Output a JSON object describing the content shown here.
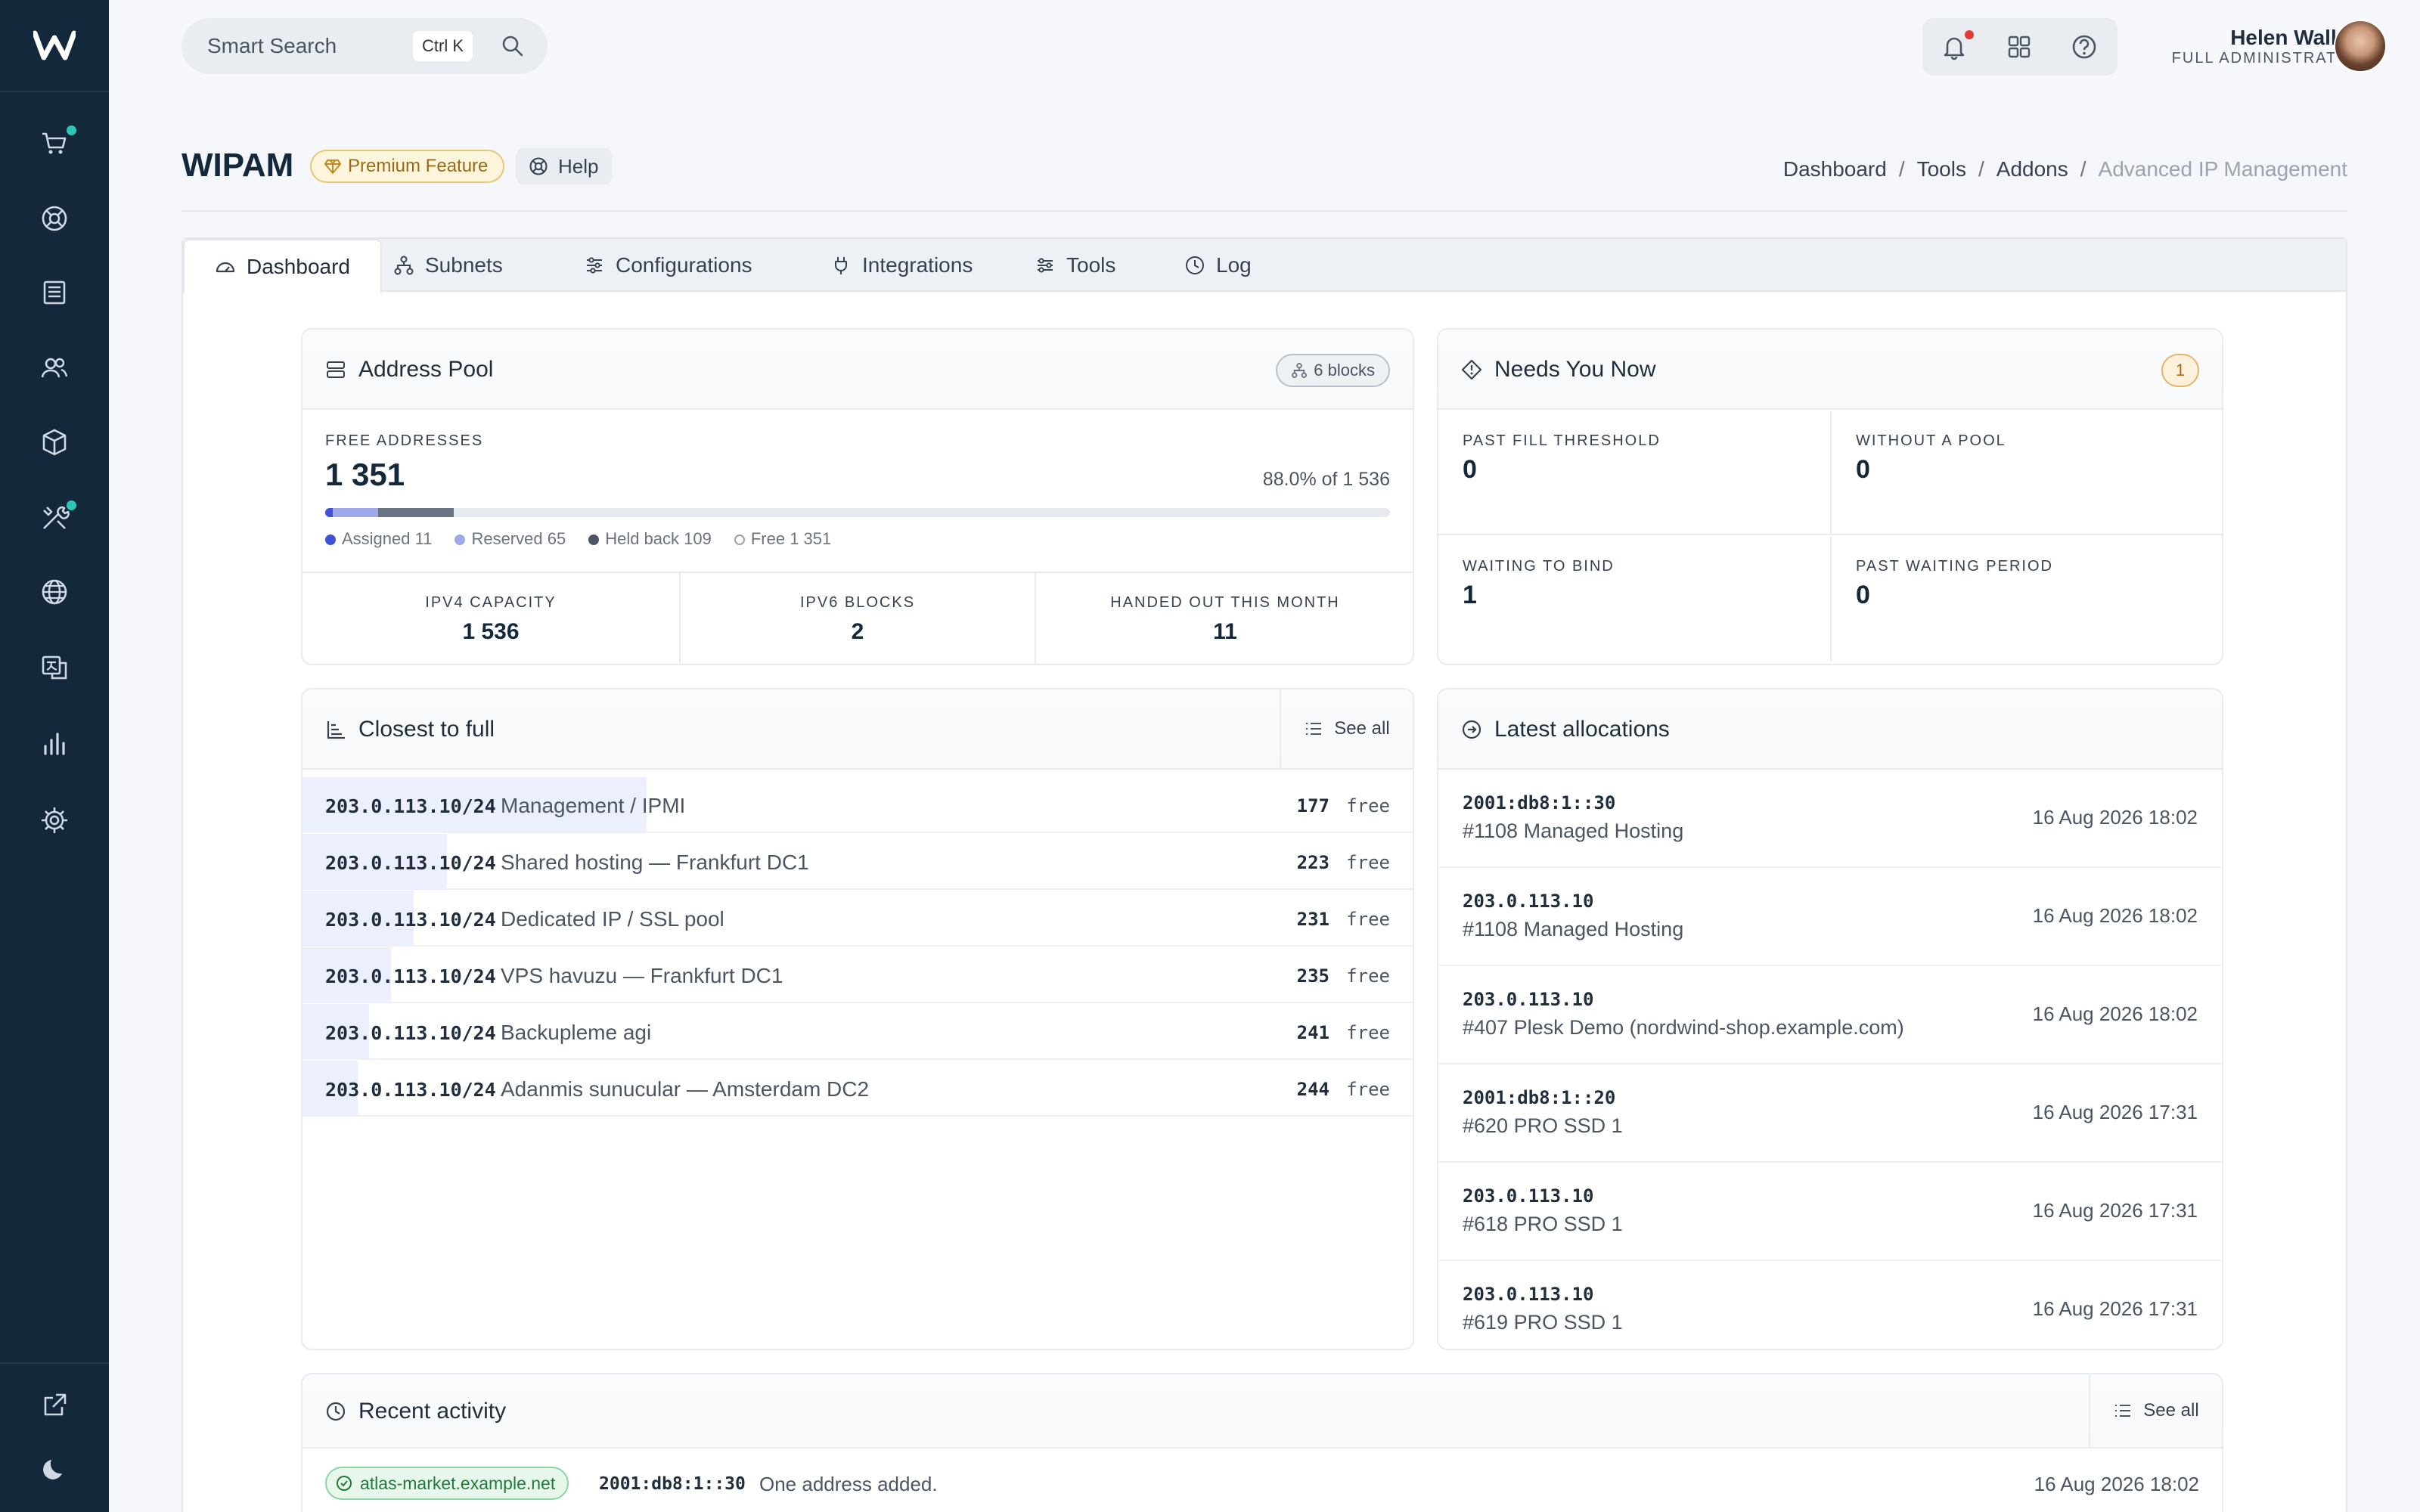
{
  "topbar": {
    "search_placeholder": "Smart Search",
    "shortcut": "Ctrl K",
    "user_name": "Helen Walker",
    "user_role": "FULL ADMINISTRATOR"
  },
  "header": {
    "title": "WIPAM",
    "premium_label": "Premium Feature",
    "help_label": "Help",
    "breadcrumb": [
      "Dashboard",
      "Tools",
      "Addons",
      "Advanced IP Management"
    ]
  },
  "tabs": [
    {
      "label": "Dashboard",
      "icon": "gauge-icon"
    },
    {
      "label": "Subnets",
      "icon": "sitemap-icon"
    },
    {
      "label": "Configurations",
      "icon": "sliders-icon"
    },
    {
      "label": "Integrations",
      "icon": "plug-icon"
    },
    {
      "label": "Tools",
      "icon": "tools-icon"
    },
    {
      "label": "Log",
      "icon": "clock-icon"
    }
  ],
  "address_pool": {
    "title": "Address Pool",
    "blocks_badge": "6 blocks",
    "free_label": "FREE ADDRESSES",
    "free_value": "1 351",
    "percent_text": "88.0% of 1 536",
    "usage": {
      "assigned": 11,
      "reserved": 65,
      "held_back": 109,
      "free": 1351,
      "total": 1536
    },
    "legend": [
      "Assigned 11",
      "Reserved 65",
      "Held back 109",
      "Free 1 351"
    ],
    "stats": [
      {
        "label": "IPV4 CAPACITY",
        "value": "1 536"
      },
      {
        "label": "IPV6 BLOCKS",
        "value": "2"
      },
      {
        "label": "HANDED OUT THIS MONTH",
        "value": "11"
      }
    ]
  },
  "needs_you_now": {
    "title": "Needs You Now",
    "badge": "1",
    "cells": [
      {
        "label": "PAST FILL THRESHOLD",
        "value": "0"
      },
      {
        "label": "WITHOUT A POOL",
        "value": "0"
      },
      {
        "label": "WAITING TO BIND",
        "value": "1"
      },
      {
        "label": "PAST WAITING PERIOD",
        "value": "0"
      }
    ]
  },
  "closest_to_full": {
    "title": "Closest to full",
    "see_all": "See all",
    "free_word": "free",
    "rows": [
      {
        "subnet": "203.0.113.10/24",
        "name": "Management / IPMI",
        "free": "177",
        "used_fraction": 0.31
      },
      {
        "subnet": "203.0.113.10/24",
        "name": "Shared hosting — Frankfurt DC1",
        "free": "223",
        "used_fraction": 0.13
      },
      {
        "subnet": "203.0.113.10/24",
        "name": "Dedicated IP / SSL pool",
        "free": "231",
        "used_fraction": 0.1
      },
      {
        "subnet": "203.0.113.10/24",
        "name": "VPS havuzu — Frankfurt DC1",
        "free": "235",
        "used_fraction": 0.08
      },
      {
        "subnet": "203.0.113.10/24",
        "name": "Backupleme agi",
        "free": "241",
        "used_fraction": 0.06
      },
      {
        "subnet": "203.0.113.10/24",
        "name": "Adanmis sunucular — Amsterdam DC2",
        "free": "244",
        "used_fraction": 0.05
      }
    ]
  },
  "latest_allocations": {
    "title": "Latest allocations",
    "rows": [
      {
        "ip": "2001:db8:1::30",
        "desc": "#1108 Managed Hosting",
        "time": "16 Aug 2026 18:02"
      },
      {
        "ip": "203.0.113.10",
        "desc": "#1108 Managed Hosting",
        "time": "16 Aug 2026 18:02"
      },
      {
        "ip": "203.0.113.10",
        "desc": "#407 Plesk Demo (nordwind-shop.example.com)",
        "time": "16 Aug 2026 18:02"
      },
      {
        "ip": "2001:db8:1::20",
        "desc": "#620 PRO SSD 1",
        "time": "16 Aug 2026 17:31"
      },
      {
        "ip": "203.0.113.10",
        "desc": "#618 PRO SSD 1",
        "time": "16 Aug 2026 17:31"
      },
      {
        "ip": "203.0.113.10",
        "desc": "#619 PRO SSD 1",
        "time": "16 Aug 2026 17:31"
      }
    ]
  },
  "recent_activity": {
    "title": "Recent activity",
    "see_all": "See all",
    "rows": [
      {
        "host": "atlas-market.example.net",
        "ip": "2001:db8:1::30",
        "message": "One address added.",
        "time": "16 Aug 2026 18:02"
      }
    ]
  },
  "colors": {
    "sidebar_bg": "#13283b",
    "accent_teal": "#2ec4b6",
    "assigned": "#3f51d9",
    "reserved": "#9fa8e8",
    "held_back": "#6b7383"
  }
}
